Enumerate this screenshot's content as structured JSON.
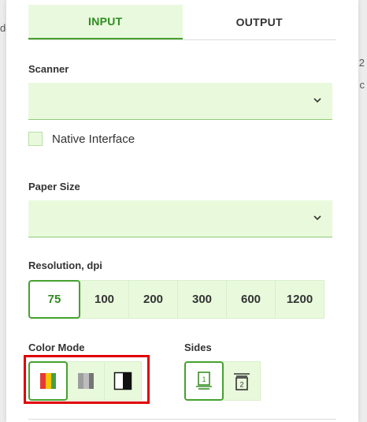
{
  "background": {
    "left_hint": "dd",
    "right_hints": [
      "2",
      "c"
    ]
  },
  "tabs": [
    {
      "label": "INPUT",
      "active": true
    },
    {
      "label": "OUTPUT",
      "active": false
    }
  ],
  "scanner": {
    "label": "Scanner",
    "value": "",
    "native_interface_label": "Native Interface",
    "native_interface_checked": false
  },
  "paper_size": {
    "label": "Paper Size",
    "value": ""
  },
  "resolution": {
    "label": "Resolution, dpi",
    "options": [
      "75",
      "100",
      "200",
      "300",
      "600",
      "1200"
    ],
    "selected": "75"
  },
  "color_mode": {
    "label": "Color Mode",
    "options": [
      "color-mode-icon",
      "grayscale-mode-icon",
      "black-white-mode-icon"
    ],
    "selected": "color-mode-icon"
  },
  "sides": {
    "label": "Sides",
    "options": [
      {
        "icon": "single-sided-icon",
        "number": "1"
      },
      {
        "icon": "double-sided-icon",
        "number": "2"
      }
    ],
    "selected": "single-sided-icon"
  },
  "colors": {
    "accent": "#45a12f",
    "field_bg": "#e9fadc",
    "highlight": "#e00000"
  }
}
